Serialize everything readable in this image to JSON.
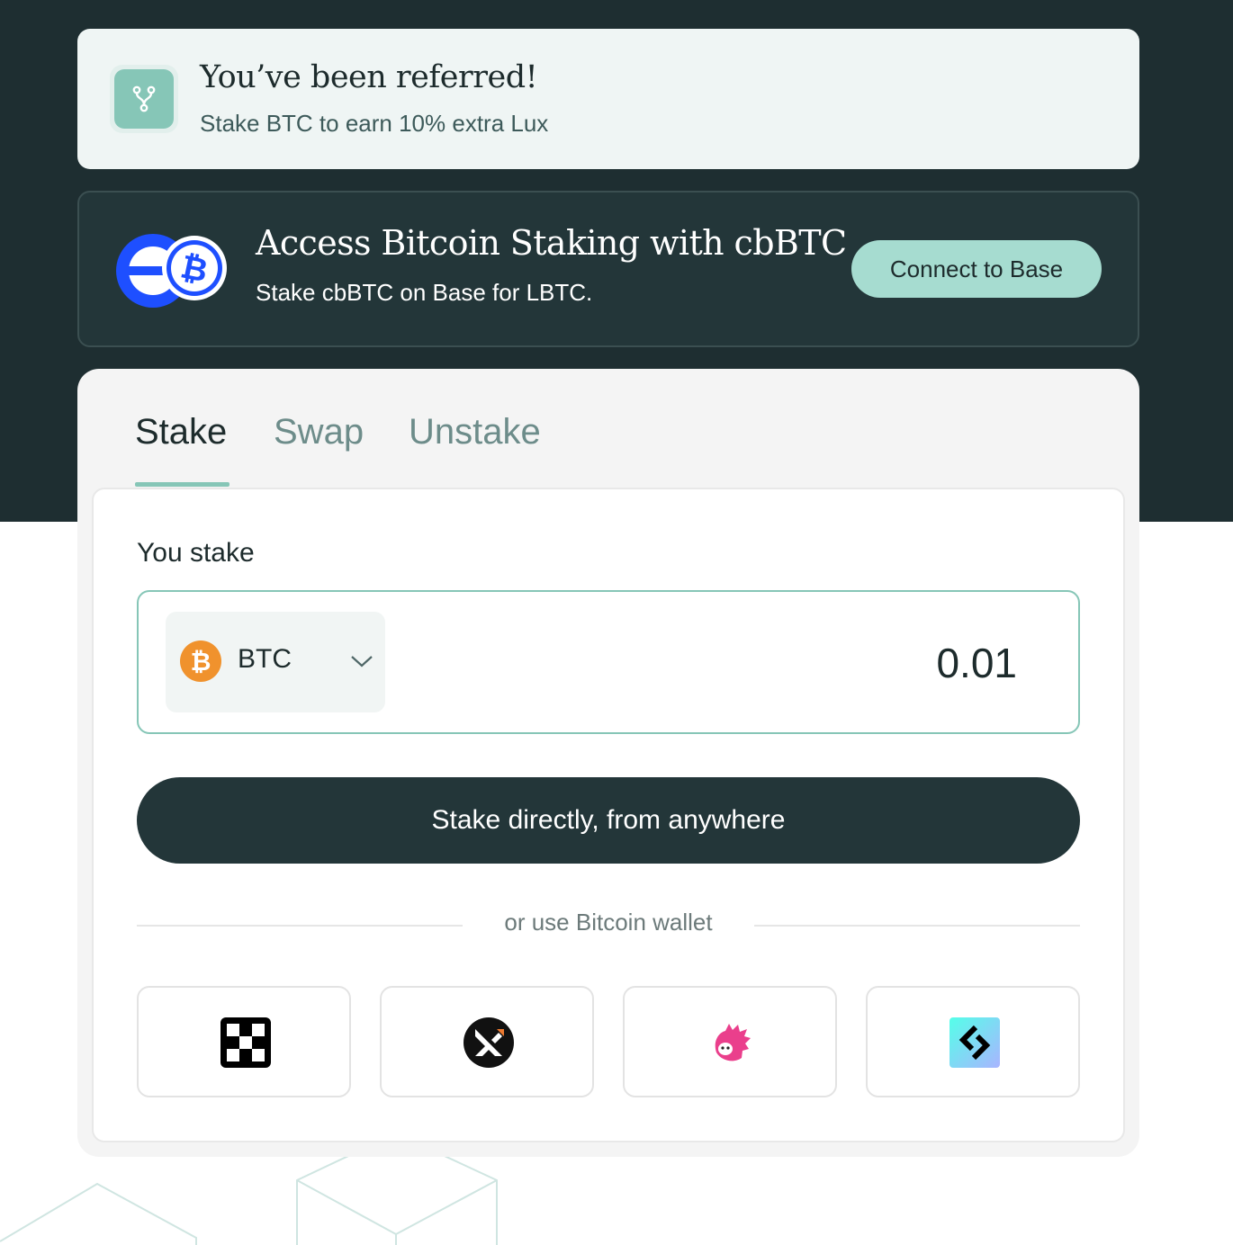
{
  "referral": {
    "title": "You’ve been referred!",
    "subtitle": "Stake BTC to earn 10% extra Lux",
    "icon": "fork-icon"
  },
  "banner": {
    "title": "Access Bitcoin Staking with cbBTC",
    "subtitle": "Stake cbBTC on Base for LBTC.",
    "button_label": "Connect to Base",
    "logos": [
      "base-logo-icon",
      "cbbtc-bitcoin-icon"
    ]
  },
  "tabs": [
    {
      "label": "Stake",
      "active": true
    },
    {
      "label": "Swap",
      "active": false
    },
    {
      "label": "Unstake",
      "active": false
    }
  ],
  "stake_form": {
    "label": "You stake",
    "token": "BTC",
    "amount": "0.01",
    "primary_button": "Stake directly, from anywhere",
    "divider_text": "or use Bitcoin wallet"
  },
  "wallets": [
    "okx-wallet-icon",
    "xverse-wallet-icon",
    "unisat-wallet-icon",
    "bitget-wallet-icon"
  ],
  "colors": {
    "dark_background": "#1e2e31",
    "accent": "#86c6b7",
    "button_mint": "#a6dcd0",
    "bitcoin_orange": "#f0922d",
    "base_blue": "#1e4fff"
  }
}
